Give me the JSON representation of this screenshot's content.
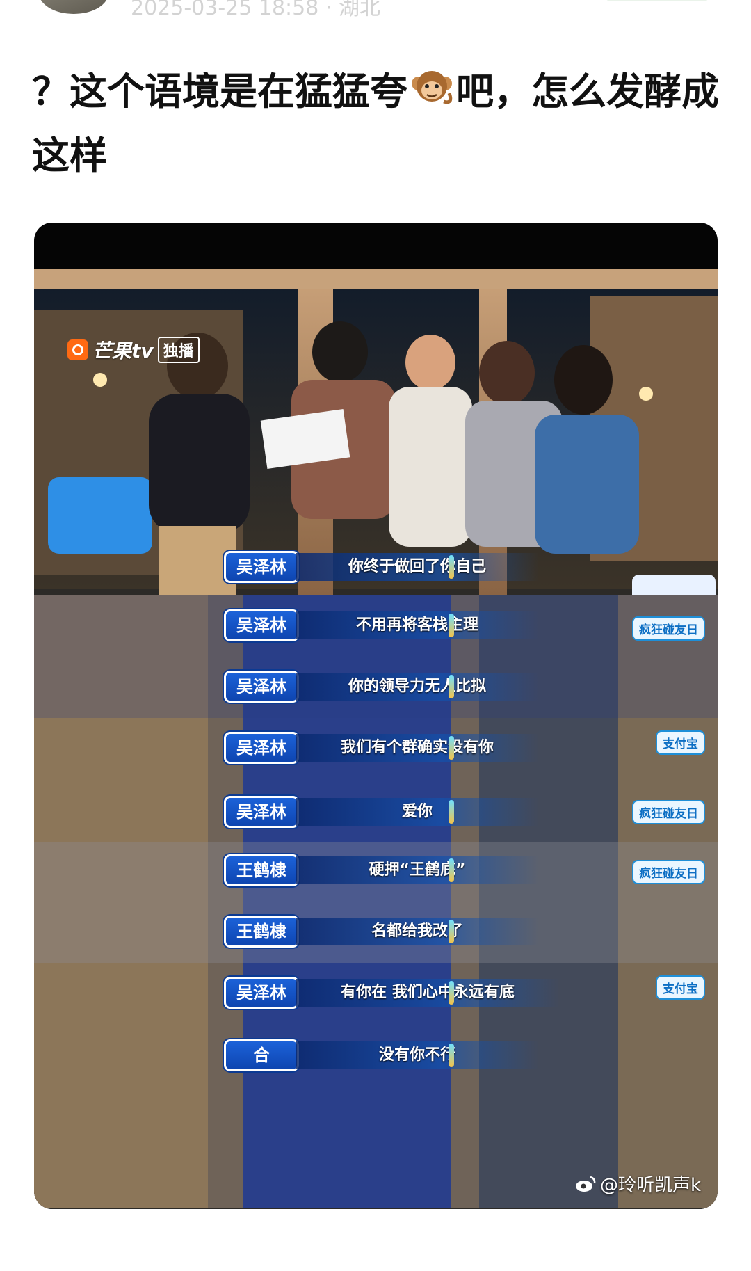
{
  "header": {
    "meta_text": "2025-03-25 18:58 · 湖北"
  },
  "post": {
    "title_before": "？这个语境是在猛猛夸",
    "emoji_name": "monkey-emoji",
    "title_after": "吧，怎么发酵成这样"
  },
  "video": {
    "channel_logo": "芒果tv",
    "exclusive_badge": "独播",
    "show_badge": "疯狂碰友日",
    "sponsor": "支付宝",
    "watermark": "@玲听凯声k",
    "subtitles": [
      {
        "speaker": "吴泽林",
        "text": "你终于做回了你自己"
      },
      {
        "speaker": "吴泽林",
        "text": "不用再将客栈主理"
      },
      {
        "speaker": "吴泽林",
        "text": "你的领导力无人比拟"
      },
      {
        "speaker": "吴泽林",
        "text": "我们有个群确实没有你"
      },
      {
        "speaker": "吴泽林",
        "text": "爱你"
      },
      {
        "speaker": "王鹤棣",
        "text": "硬押“王鹤底”"
      },
      {
        "speaker": "王鹤棣",
        "text": "名都给我改了"
      },
      {
        "speaker": "吴泽林",
        "text": "有你在 我们心中永远有底"
      },
      {
        "speaker": "合",
        "text": "没有你不行"
      }
    ]
  }
}
